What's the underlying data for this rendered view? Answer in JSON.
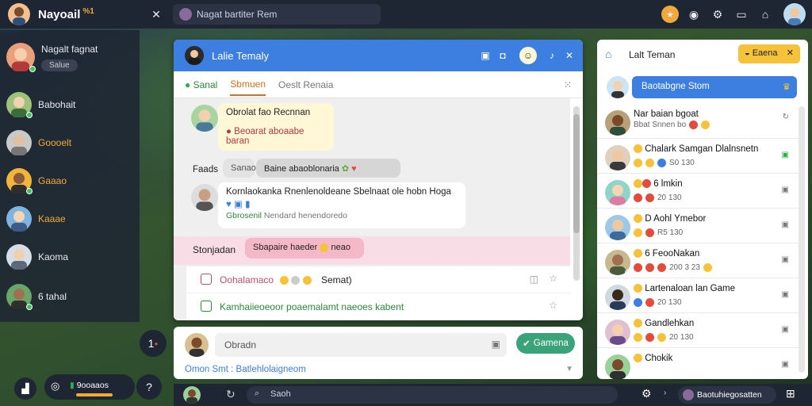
{
  "app": {
    "title": "Nayoail",
    "badge": "%1"
  },
  "topbar": {
    "search_text": "Nagat bartiter Rem"
  },
  "left_sidebar": {
    "items": [
      {
        "name": "Nagalt fagnat",
        "sub": "Salue",
        "orange": false
      },
      {
        "name": "Babohait",
        "orange": false
      },
      {
        "name": "Goooelt",
        "orange": true
      },
      {
        "name": "Gaaao",
        "orange": true
      },
      {
        "name": "Kaaae",
        "orange": true
      },
      {
        "name": "Kaoma",
        "orange": false
      },
      {
        "name": "6 tahal",
        "orange": false
      }
    ]
  },
  "chat": {
    "header_title": "Lalie Temaly",
    "tabs": [
      "Sanal",
      "Sbmuen",
      "Oeslt Renaia"
    ],
    "active_tab": 1,
    "messages": [
      {
        "title": "Obrolat fao Recnnan",
        "sub": "Beoarat aboaabe baran"
      },
      {
        "title": "Faads",
        "pill": "Sanao",
        "pill2": "Baine abaoblonaria"
      },
      {
        "title": "Kornlaokanka Rnenlenoldeane Sbelnaat ole hobn Hoga",
        "sub": "Gbrosenil",
        "sub2": "Nendard henendoredo"
      },
      {
        "title": "Stonjadan",
        "pill": "Sbapaire haeder",
        "pill2": "neao"
      }
    ],
    "list_rows": [
      {
        "label": "Oohalamaco",
        "right": "Semat)"
      },
      {
        "label": "Kamhaiieoeoor poaemalamt naeoes kabent"
      }
    ]
  },
  "compose": {
    "placeholder": "Obradn",
    "send_label": "Gamena",
    "status": "Omon Smt : Batlehlolaigneom"
  },
  "right_panel": {
    "title": "Lalt Teman",
    "tag": "Eaena",
    "search_button": "Baotabgne Stom",
    "contacts": [
      {
        "name": "Nar baian bgoat",
        "sub": "Bbat Snnen bo",
        "time": ""
      },
      {
        "name": "Chalark Samgan Dlalnsnetn",
        "sub": "S0 130",
        "time": ""
      },
      {
        "name": "6 lmkin",
        "sub": "20 130",
        "time": ""
      },
      {
        "name": "D Aohl Ymebor",
        "sub": "R5 130",
        "time": ""
      },
      {
        "name": "6 FeooNakan",
        "sub": "200 3 23",
        "time": ""
      },
      {
        "name": "Lartenaloan lan Game",
        "sub": "20 130",
        "time": ""
      },
      {
        "name": "Gandlehkan",
        "sub": "20 130",
        "time": ""
      },
      {
        "name": "Chokik",
        "sub": "",
        "time": ""
      }
    ]
  },
  "bottom_left": {
    "status": "9ooaaos",
    "count": "1"
  },
  "bottombar": {
    "search_text": "Saoh",
    "right_text": "Baotuhiegosatten"
  },
  "colors": {
    "accent": "#3d7fe0",
    "orange": "#f2a93b",
    "dark": "#1e2533"
  }
}
